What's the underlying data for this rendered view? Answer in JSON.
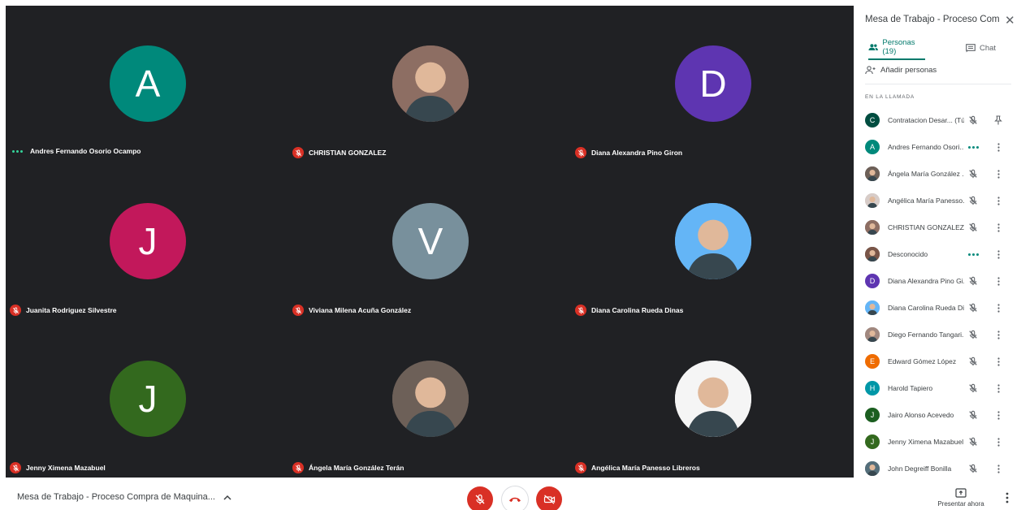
{
  "tiles": [
    {
      "name": "Andres Fernando Osorio Ocampo",
      "initial": "A",
      "color": "#00897b",
      "photo": false,
      "status": "speaking"
    },
    {
      "name": "CHRISTIAN GONZALEZ",
      "initial": "",
      "color": "#8d6e63",
      "photo": true,
      "status": "muted"
    },
    {
      "name": "Diana Alexandra Pino Giron",
      "initial": "D",
      "color": "#5e35b1",
      "photo": false,
      "status": "muted"
    },
    {
      "name": "Juanita Rodriguez Silvestre",
      "initial": "J",
      "color": "#c2185b",
      "photo": false,
      "status": "muted"
    },
    {
      "name": "Viviana Milena Acuña González",
      "initial": "V",
      "color": "#78909c",
      "photo": false,
      "status": "muted"
    },
    {
      "name": "Diana Carolina Rueda Dinas",
      "initial": "",
      "color": "#64b5f6",
      "photo": true,
      "status": "muted"
    },
    {
      "name": "Jenny Ximena Mazabuel",
      "initial": "J",
      "color": "#33691e",
      "photo": false,
      "status": "muted"
    },
    {
      "name": "Ángela María González Terán",
      "initial": "",
      "color": "#6d6058",
      "photo": true,
      "status": "muted"
    },
    {
      "name": "Angélica María Panesso Libreros",
      "initial": "",
      "color": "#f5f5f5",
      "photo": true,
      "status": "muted"
    }
  ],
  "panel": {
    "title": "Mesa de Trabajo - Proceso Comp...",
    "tab_people": "Personas (19)",
    "tab_chat": "Chat",
    "add_people": "Añadir personas",
    "section_label": "EN LA LLAMADA",
    "participants": [
      {
        "name": "Contratacion Desar... (Tú)",
        "initial": "C",
        "color": "#004d40",
        "photo": false,
        "status": "muted",
        "action": "pin"
      },
      {
        "name": "Andres Fernando Osori...",
        "initial": "A",
        "color": "#00897b",
        "photo": false,
        "status": "speaking",
        "action": "menu"
      },
      {
        "name": "Ángela María González ...",
        "initial": "",
        "color": "#6d6058",
        "photo": true,
        "status": "muted",
        "action": "menu"
      },
      {
        "name": "Angélica María Panesso...",
        "initial": "",
        "color": "#d7ccc8",
        "photo": true,
        "status": "muted",
        "action": "menu"
      },
      {
        "name": "CHRISTIAN GONZALEZ",
        "initial": "",
        "color": "#8d6e63",
        "photo": true,
        "status": "muted",
        "action": "menu"
      },
      {
        "name": "Desconocido",
        "initial": "",
        "color": "#795548",
        "photo": true,
        "status": "speaking",
        "action": "menu"
      },
      {
        "name": "Diana Alexandra Pino Gi...",
        "initial": "D",
        "color": "#5e35b1",
        "photo": false,
        "status": "muted",
        "action": "menu"
      },
      {
        "name": "Diana Carolina Rueda Di...",
        "initial": "",
        "color": "#64b5f6",
        "photo": true,
        "status": "muted",
        "action": "menu"
      },
      {
        "name": "Diego Fernando Tangari...",
        "initial": "",
        "color": "#a1887f",
        "photo": true,
        "status": "muted",
        "action": "menu"
      },
      {
        "name": "Edward Gómez López",
        "initial": "E",
        "color": "#ef6c00",
        "photo": false,
        "status": "muted",
        "action": "menu"
      },
      {
        "name": "Harold Tapiero",
        "initial": "H",
        "color": "#0097a7",
        "photo": false,
        "status": "muted",
        "action": "menu"
      },
      {
        "name": "Jairo Alonso Acevedo",
        "initial": "J",
        "color": "#1b5e20",
        "photo": false,
        "status": "muted",
        "action": "menu"
      },
      {
        "name": "Jenny Ximena Mazabuel",
        "initial": "J",
        "color": "#33691e",
        "photo": false,
        "status": "muted",
        "action": "menu"
      },
      {
        "name": "John Degreiff Bonilla",
        "initial": "",
        "color": "#546e7a",
        "photo": true,
        "status": "muted",
        "action": "menu"
      }
    ]
  },
  "bottom": {
    "meeting_title": "Mesa de Trabajo - Proceso Compra de Maquina...",
    "present_label": "Presentar ahora"
  }
}
